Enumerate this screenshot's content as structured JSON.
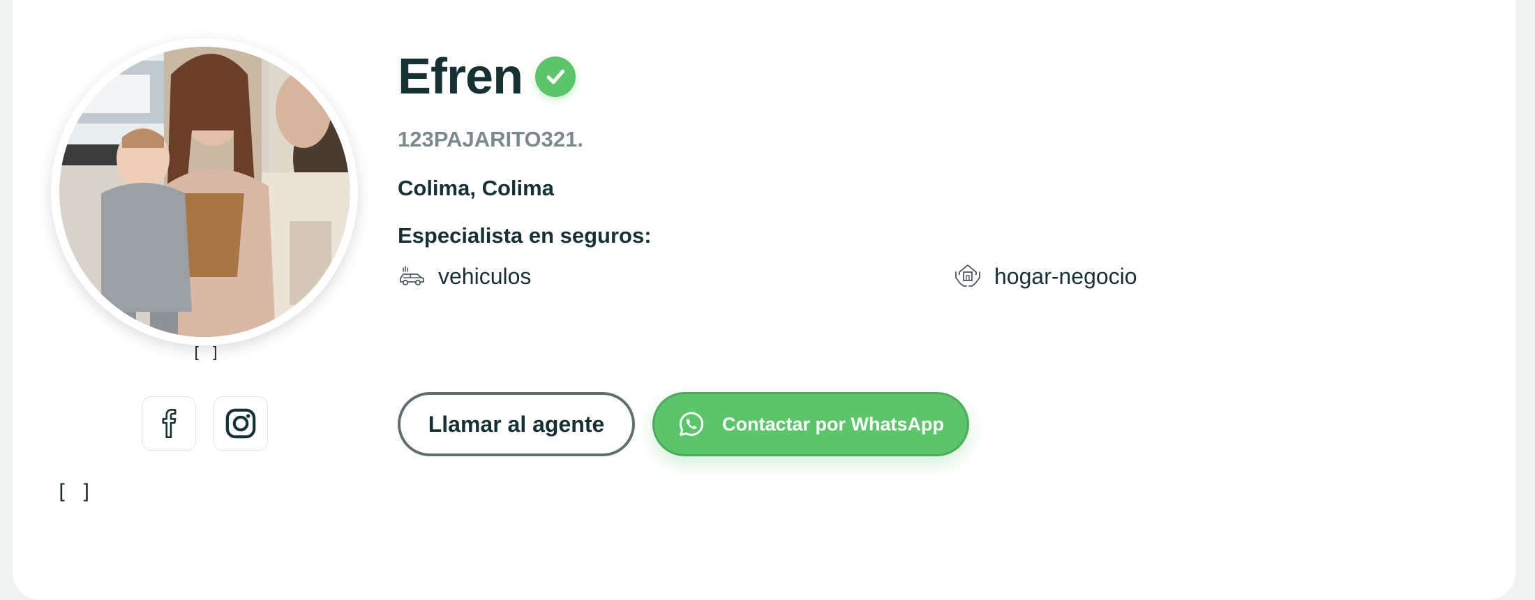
{
  "agent": {
    "name": "Efren",
    "username": "123PAJARITO321.",
    "location": "Colima, Colima",
    "photo_caption": "[ ]",
    "bottom_caption": "[ ]"
  },
  "specialties": {
    "heading": "Especialista en seguros:",
    "items": [
      {
        "label": "vehiculos",
        "icon": "car-icon"
      },
      {
        "label": "hogar-negocio",
        "icon": "house-hands-icon"
      }
    ]
  },
  "social": [
    {
      "icon": "facebook-icon"
    },
    {
      "icon": "instagram-icon"
    }
  ],
  "actions": {
    "call_label": "Llamar al agente",
    "whatsapp_label": "Contactar por WhatsApp"
  },
  "colors": {
    "accent_green": "#5cc56c",
    "text_dark": "#163033",
    "text_muted": "#7a8a8c"
  }
}
